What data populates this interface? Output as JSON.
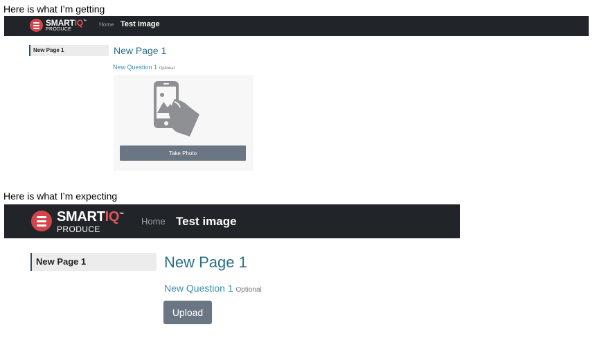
{
  "captions": {
    "getting": "Here is what I’m getting",
    "expecting": "Here is what I’m expecting"
  },
  "navbar": {
    "brand_main": "SMART",
    "brand_accent": "IQ",
    "brand_tm": "™",
    "brand_sub": "PRODUCE",
    "home_link": "Home",
    "page_title": "Test image"
  },
  "sidebar": {
    "items": [
      {
        "label": "New Page 1"
      }
    ]
  },
  "main": {
    "heading": "New Page 1",
    "question_label": "New Question 1",
    "optional_tag": "Optional"
  },
  "buttons": {
    "take_photo": "Take Photo",
    "upload": "Upload"
  },
  "colors": {
    "navbar_bg": "#212428",
    "logo_red": "#d2454b",
    "heading_blue": "#2b6e86",
    "question_blue": "#3d8fb0",
    "button_gray": "#6b7684",
    "sidebar_bg": "#ececec"
  },
  "icons": {
    "photo_placeholder": "hand-holding-phone-icon",
    "logo": "smartiq-logo-icon"
  }
}
